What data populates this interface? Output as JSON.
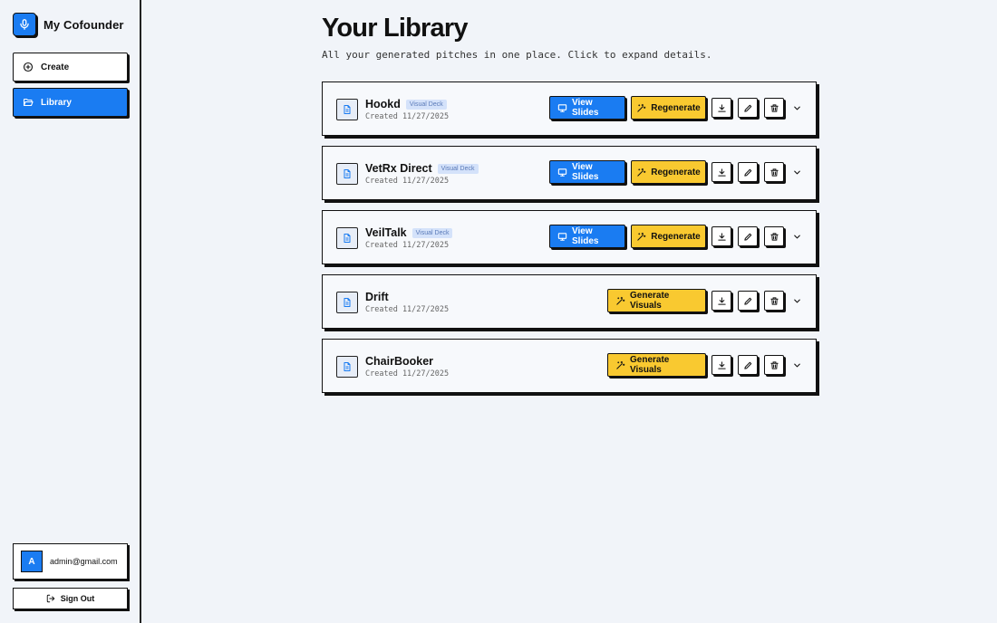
{
  "sidebar": {
    "brand": "My Cofounder",
    "nav": [
      {
        "label": "Create",
        "icon": "plus-circle-icon"
      },
      {
        "label": "Library",
        "icon": "folder-open-icon"
      }
    ],
    "user": {
      "initial": "A",
      "email": "admin@gmail.com"
    },
    "signout_label": "Sign Out"
  },
  "main": {
    "title": "Your Library",
    "subtitle": "All your generated pitches in one place. Click to expand details."
  },
  "labels": {
    "view_slides": "View Slides",
    "regenerate": "Regenerate",
    "generate_visuals": "Generate Visuals"
  },
  "pitches": [
    {
      "name": "Hookd",
      "badge": "Visual Deck",
      "date": "Created 11/27/2025"
    },
    {
      "name": "VetRx Direct",
      "badge": "Visual Deck",
      "date": "Created 11/27/2025"
    },
    {
      "name": "VeilTalk",
      "badge": "Visual Deck",
      "date": "Created 11/27/2025"
    },
    {
      "name": "Drift",
      "date": "Created 11/27/2025"
    },
    {
      "name": "ChairBooker",
      "date": "Created 11/27/2025"
    }
  ],
  "colors": {
    "accent": "#1a7cf2",
    "yellow": "#f9c930",
    "background": "#f1f4f9"
  }
}
